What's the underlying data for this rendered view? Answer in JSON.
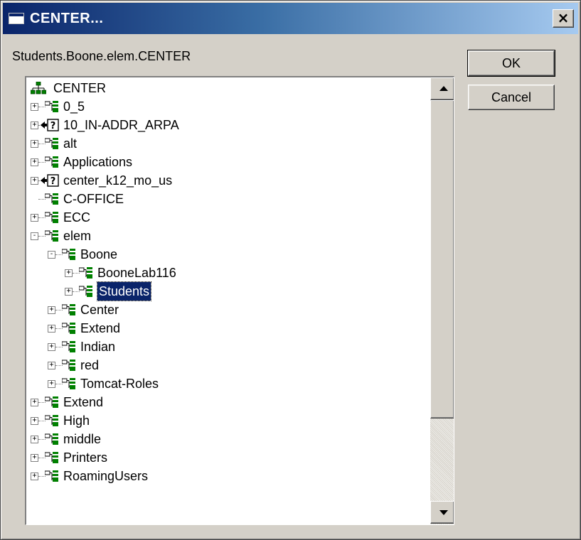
{
  "window": {
    "title": "CENTER..."
  },
  "path_label": "Students.Boone.elem.CENTER",
  "buttons": {
    "ok": "OK",
    "cancel": "Cancel",
    "close": "×"
  },
  "tree": {
    "root": "CENTER",
    "nodes": [
      {
        "label": "0_5",
        "level": 1,
        "expander": "+",
        "icon": "ou-icon"
      },
      {
        "label": "10_IN-ADDR_ARPA",
        "level": 1,
        "expander": "+",
        "icon": "unknown-object-icon"
      },
      {
        "label": "alt",
        "level": 1,
        "expander": "+",
        "icon": "ou-icon"
      },
      {
        "label": "Applications",
        "level": 1,
        "expander": "+",
        "icon": "ou-icon"
      },
      {
        "label": "center_k12_mo_us",
        "level": 1,
        "expander": "+",
        "icon": "unknown-object-icon"
      },
      {
        "label": "C-OFFICE",
        "level": 1,
        "expander": "",
        "icon": "ou-icon"
      },
      {
        "label": "ECC",
        "level": 1,
        "expander": "+",
        "icon": "ou-icon"
      },
      {
        "label": "elem",
        "level": 1,
        "expander": "-",
        "icon": "ou-icon"
      },
      {
        "label": "Boone",
        "level": 2,
        "expander": "-",
        "icon": "ou-icon"
      },
      {
        "label": "BooneLab116",
        "level": 3,
        "expander": "+",
        "icon": "ou-icon"
      },
      {
        "label": "Students",
        "level": 3,
        "expander": "+",
        "icon": "ou-icon",
        "selected": true
      },
      {
        "label": "Center",
        "level": 2,
        "expander": "+",
        "icon": "ou-icon"
      },
      {
        "label": "Extend",
        "level": 2,
        "expander": "+",
        "icon": "ou-icon"
      },
      {
        "label": "Indian",
        "level": 2,
        "expander": "+",
        "icon": "ou-icon"
      },
      {
        "label": "red",
        "level": 2,
        "expander": "+",
        "icon": "ou-icon"
      },
      {
        "label": "Tomcat-Roles",
        "level": 2,
        "expander": "+",
        "icon": "ou-icon"
      },
      {
        "label": "Extend",
        "level": 1,
        "expander": "+",
        "icon": "ou-icon"
      },
      {
        "label": "High",
        "level": 1,
        "expander": "+",
        "icon": "ou-icon"
      },
      {
        "label": "middle",
        "level": 1,
        "expander": "+",
        "icon": "ou-icon"
      },
      {
        "label": "Printers",
        "level": 1,
        "expander": "+",
        "icon": "ou-icon"
      },
      {
        "label": "RoamingUsers",
        "level": 1,
        "expander": "+",
        "icon": "ou-icon"
      }
    ]
  },
  "colors": {
    "titlebar_start": "#0a246a",
    "titlebar_end": "#a6caf0",
    "selection": "#0a246a",
    "face": "#d4d0c8"
  }
}
